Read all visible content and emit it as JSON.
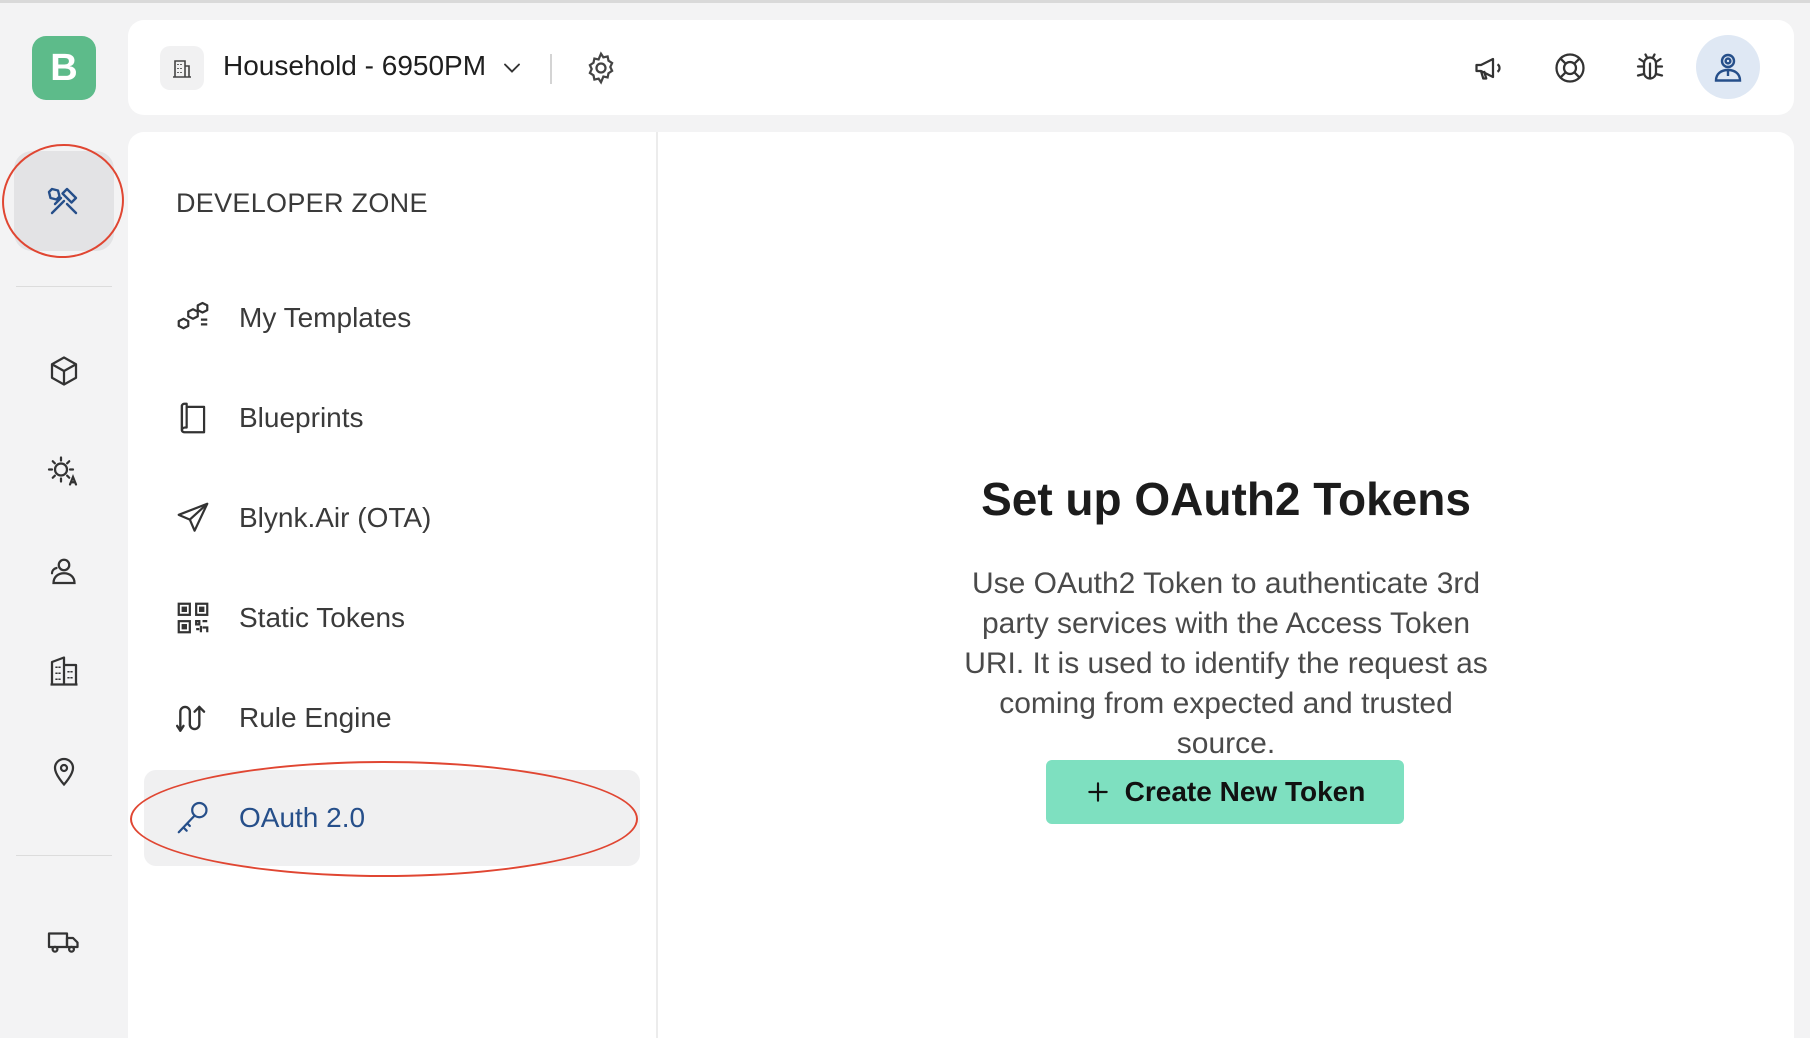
{
  "app": {
    "logo_letter": "B"
  },
  "header": {
    "org_name": "Household - 6950PM",
    "icons": [
      "megaphone-icon",
      "lifebuoy-icon",
      "bug-icon",
      "user-avatar-icon"
    ]
  },
  "rail": {
    "items": [
      "developer-tools",
      "products",
      "automations",
      "users",
      "organizations",
      "locations",
      "fleet"
    ],
    "active": "developer-tools"
  },
  "developer_zone": {
    "title": "DEVELOPER ZONE",
    "items": [
      {
        "label": "My Templates",
        "icon": "templates-icon"
      },
      {
        "label": "Blueprints",
        "icon": "blueprint-icon"
      },
      {
        "label": "Blynk.Air (OTA)",
        "icon": "paper-plane-icon"
      },
      {
        "label": "Static Tokens",
        "icon": "qr-code-icon"
      },
      {
        "label": "Rule Engine",
        "icon": "rule-engine-icon"
      },
      {
        "label": "OAuth 2.0",
        "icon": "key-icon",
        "active": true
      }
    ]
  },
  "main": {
    "title": "Set up OAuth2 Tokens",
    "description": "Use OAuth2 Token to authenticate 3rd party services with the Access Token URI. It is used to identify the request as coming from expected and trusted source.",
    "button_label": "Create New Token"
  },
  "colors": {
    "brand": "#5dbb8a",
    "button": "#7ee0c0",
    "active_text": "#264f8a",
    "annotation": "#e04632"
  }
}
